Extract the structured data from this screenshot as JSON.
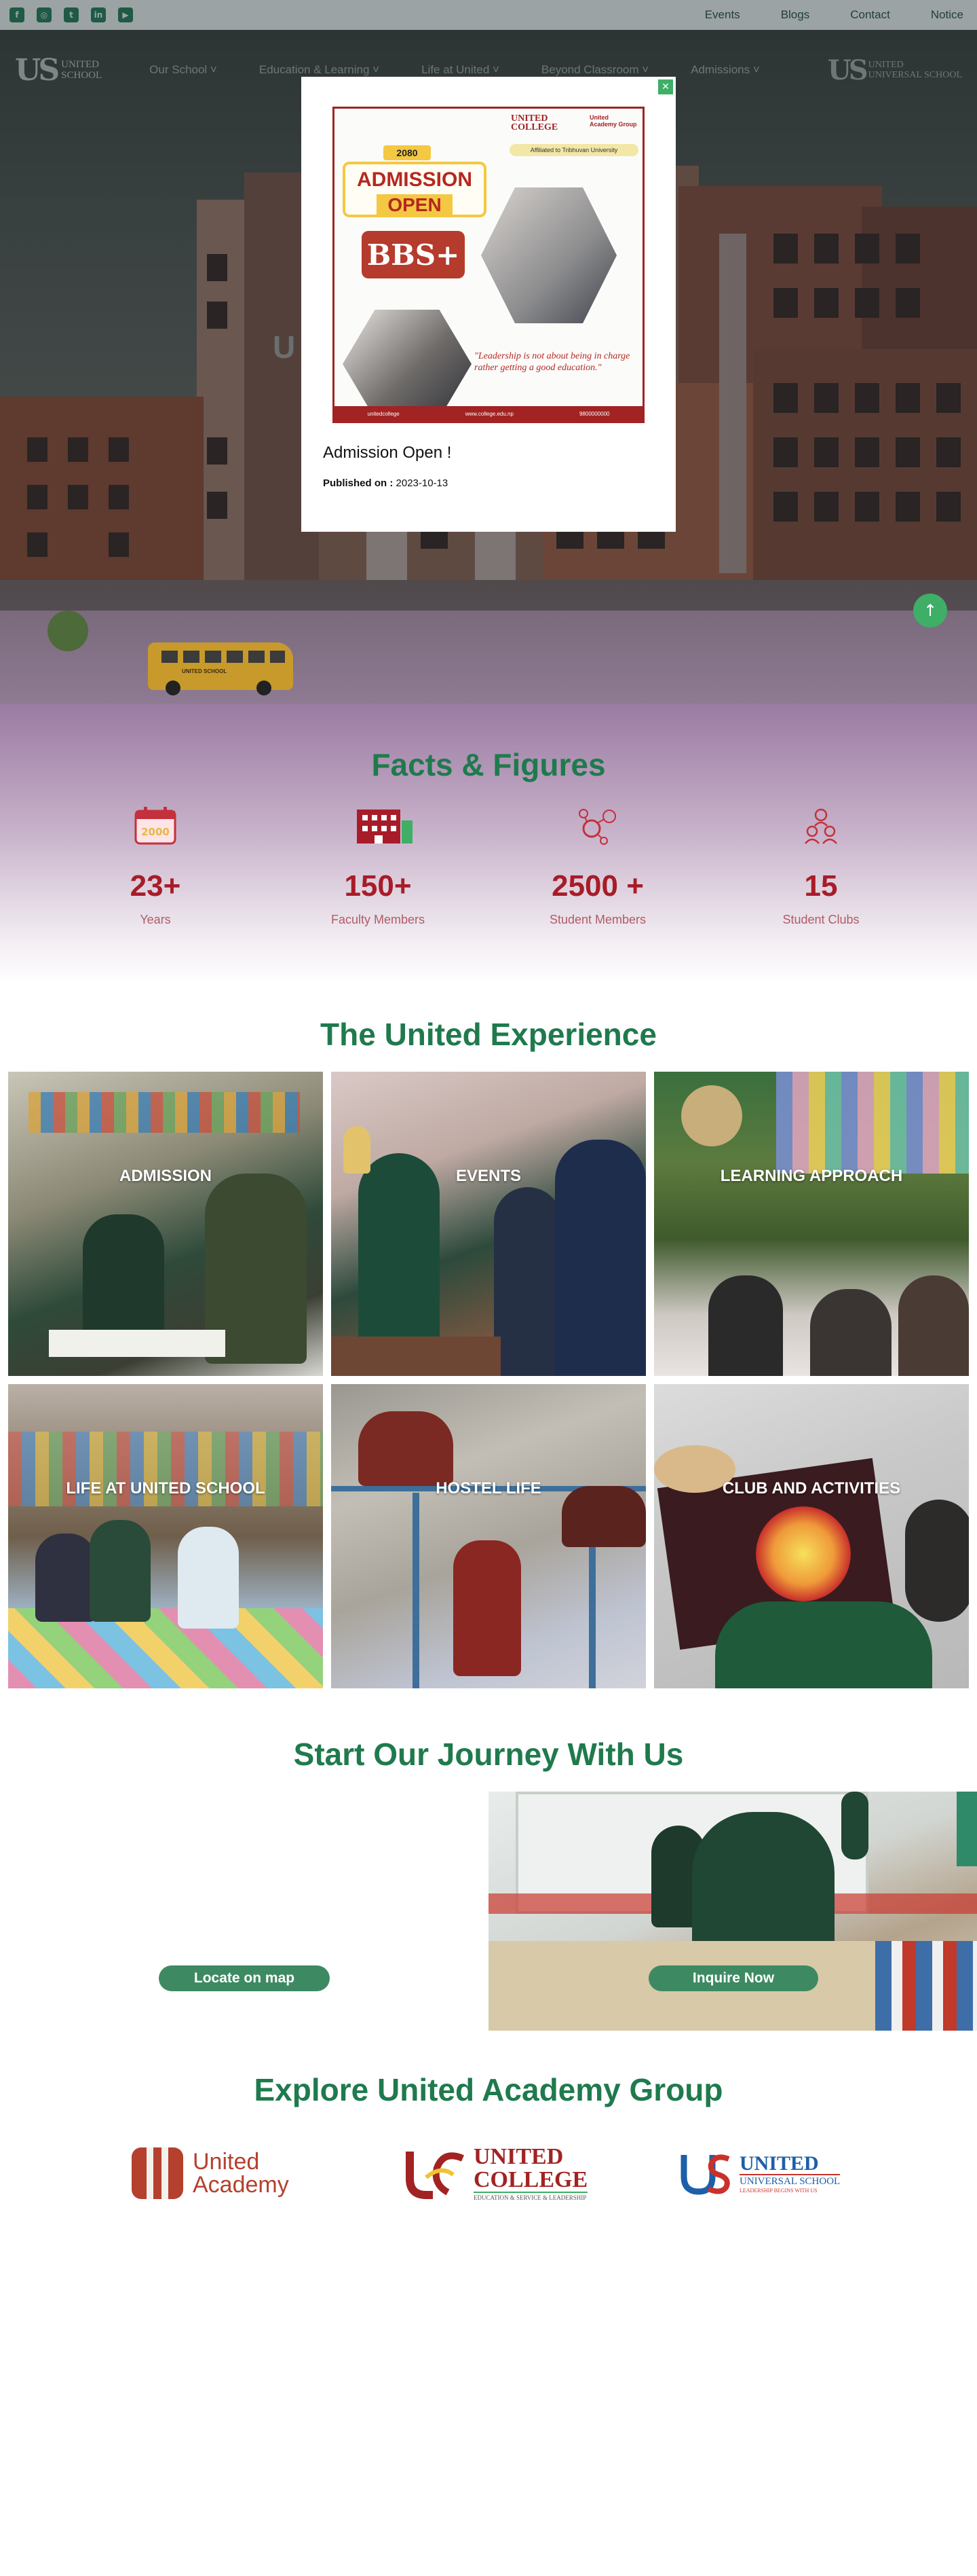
{
  "topbar": {
    "social": [
      {
        "icon": "facebook-icon",
        "glyph": "f"
      },
      {
        "icon": "instagram-icon",
        "glyph": "◎"
      },
      {
        "icon": "twitter-icon",
        "glyph": "t"
      },
      {
        "icon": "linkedin-icon",
        "glyph": "in"
      },
      {
        "icon": "youtube-icon",
        "glyph": "▶"
      }
    ],
    "links": [
      "Events",
      "Blogs",
      "Contact",
      "Notice"
    ]
  },
  "nav": {
    "logo_line1": "UNITED",
    "logo_line2": "SCHOOL",
    "items": [
      "Our School ˅",
      "Education & Learning ˅",
      "Life at United ˅",
      "Beyond Classroom ˅",
      "Admissions ˅"
    ],
    "logo2_line1": "UNITED",
    "logo2_line2": "UNIVERSAL SCHOOL"
  },
  "hero": {
    "title": "U                              ES",
    "bus_label": "UNITED SCHOOL",
    "scroll_top_glyph": "↑"
  },
  "modal": {
    "close_glyph": "✕",
    "poster": {
      "brand1_line1": "UNITED",
      "brand1_line2": "COLLEGE",
      "brand2": "United Academy Group",
      "affiliation": "Affiliated to Tribhuvan University",
      "year": "2080",
      "admission_line1": "ADMISSION",
      "admission_line2": "OPEN",
      "program": "BBS+",
      "quote": "\"Leadership is not about being in charge rather getting a good education.\"",
      "footer": [
        "unitedcollege",
        "www.college.edu.np",
        "9800000000"
      ]
    },
    "title": "Admission Open !",
    "date_label": "Published on :",
    "date_value": "2023-10-13"
  },
  "facts": {
    "title": "Facts & Figures",
    "items": [
      {
        "icon": "calendar-icon",
        "value": "23+",
        "label": "Years"
      },
      {
        "icon": "building-icon",
        "value": "150+",
        "label": "Faculty Members"
      },
      {
        "icon": "network-icon",
        "value": "2500 +",
        "label": "Student Members"
      },
      {
        "icon": "group-icon",
        "value": "15",
        "label": "Student Clubs"
      }
    ]
  },
  "experience": {
    "title": "The United Experience",
    "tiles": [
      "ADMISSION",
      "EVENTS",
      "LEARNING APPROACH",
      "LIFE AT UNITED SCHOOL",
      "HOSTEL LIFE",
      "CLUB AND ACTIVITIES"
    ]
  },
  "journey": {
    "title": "Start Our Journey With Us",
    "locate_label": "Locate on map",
    "inquire_label": "Inquire Now"
  },
  "explore": {
    "title": "Explore United Academy Group",
    "brands": [
      {
        "line1": "United",
        "line2": "Academy"
      },
      {
        "line1": "UNITED",
        "line2": "COLLEGE",
        "line3": "EDUCATION & SERVICE & LEADERSHIP"
      },
      {
        "line1": "UNITED",
        "line2": "UNIVERSAL SCHOOL",
        "line3": "LEADERSHIP BEGINS WITH US"
      }
    ]
  },
  "colors": {
    "brand_green": "#1f7a4d",
    "button_green": "#3d8a62",
    "accent_red": "#a71c28"
  }
}
